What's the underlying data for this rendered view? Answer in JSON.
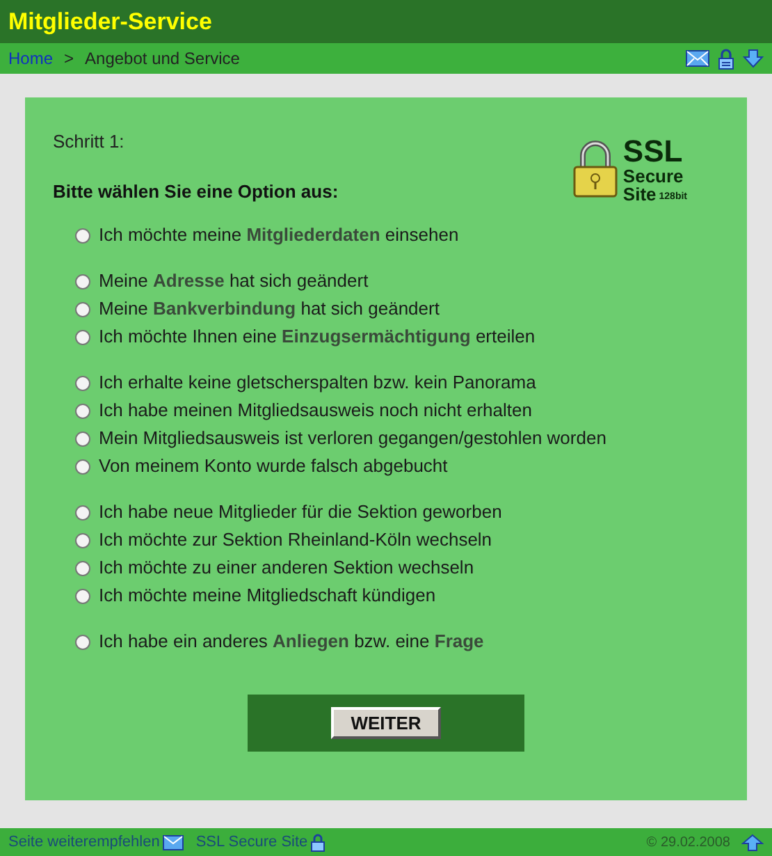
{
  "header": {
    "title": "Mitglieder-Service"
  },
  "breadcrumb": [
    {
      "label": "Home",
      "link": true
    },
    {
      "label": ">",
      "link": false
    },
    {
      "label": "Angebot und Service",
      "link": false
    }
  ],
  "step": "Schritt 1:",
  "prompt": "Bitte wählen Sie eine Option aus:",
  "ssl_badge": {
    "big": "SSL",
    "line1": "Secure",
    "line2": "Site",
    "bits": "128bit"
  },
  "option_groups": [
    [
      {
        "text": "Ich möchte meine **Mitgliederdaten** einsehen",
        "selected": false
      }
    ],
    [
      {
        "text": "Meine **Adresse** hat sich geändert",
        "selected": false
      },
      {
        "text": "Meine **Bankverbindung** hat sich geändert",
        "selected": false
      },
      {
        "text": "Ich möchte Ihnen eine **Einzugsermächtigung** erteilen",
        "selected": false
      }
    ],
    [
      {
        "text": "Ich erhalte keine gletscherspalten bzw. kein Panorama",
        "selected": false
      },
      {
        "text": "Ich habe meinen Mitgliedsausweis noch nicht erhalten",
        "selected": false
      },
      {
        "text": "Mein Mitgliedsausweis ist verloren gegangen/gestohlen worden",
        "selected": false
      },
      {
        "text": "Von meinem Konto wurde falsch abgebucht",
        "selected": false
      }
    ],
    [
      {
        "text": "Ich habe neue Mitglieder für die Sektion geworben",
        "selected": false
      },
      {
        "text": "Ich möchte zur Sektion Rheinland-Köln wechseln",
        "selected": false
      },
      {
        "text": "Ich möchte zu einer anderen Sektion wechseln",
        "selected": false
      },
      {
        "text": "Ich möchte meine Mitgliedschaft kündigen",
        "selected": false
      }
    ],
    [
      {
        "text": "Ich habe ein anderes **Anliegen** bzw. eine **Frage**",
        "selected": false
      }
    ]
  ],
  "submit": "WEITER",
  "footer": {
    "recommend": "Seite weiterempfehlen",
    "ssl": "SSL Secure Site",
    "copyright": "© 29.02.2008"
  }
}
